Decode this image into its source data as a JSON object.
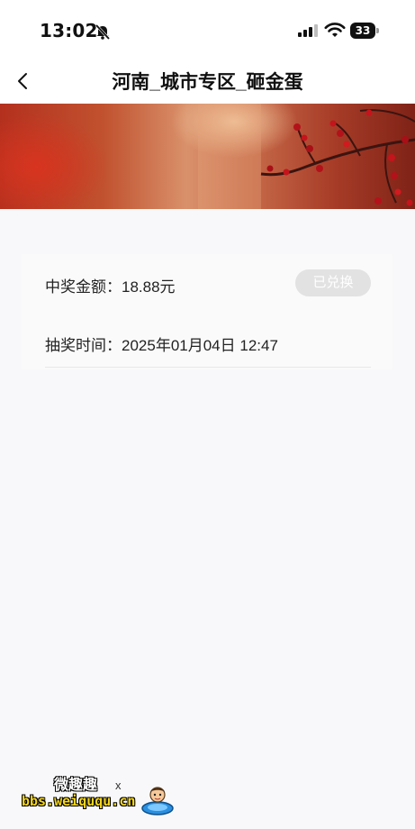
{
  "status_bar": {
    "time": "13:02",
    "battery": "33"
  },
  "nav": {
    "title": "河南_城市专区_砸金蛋"
  },
  "record": {
    "amount_label": "中奖金额：",
    "amount_value": "18.88元",
    "time_label": "抽奖时间：",
    "time_value": "2025年01月04日 12:47",
    "redeem_button": "已兑换"
  },
  "watermark": {
    "brand": "微趣趣",
    "url": "bbs.weiququ.cn",
    "mark": "x"
  },
  "colors": {
    "page_background": "#f8f8fa",
    "button_disabled": "#e2e2e2",
    "watermark_url": "#f5d51b"
  }
}
